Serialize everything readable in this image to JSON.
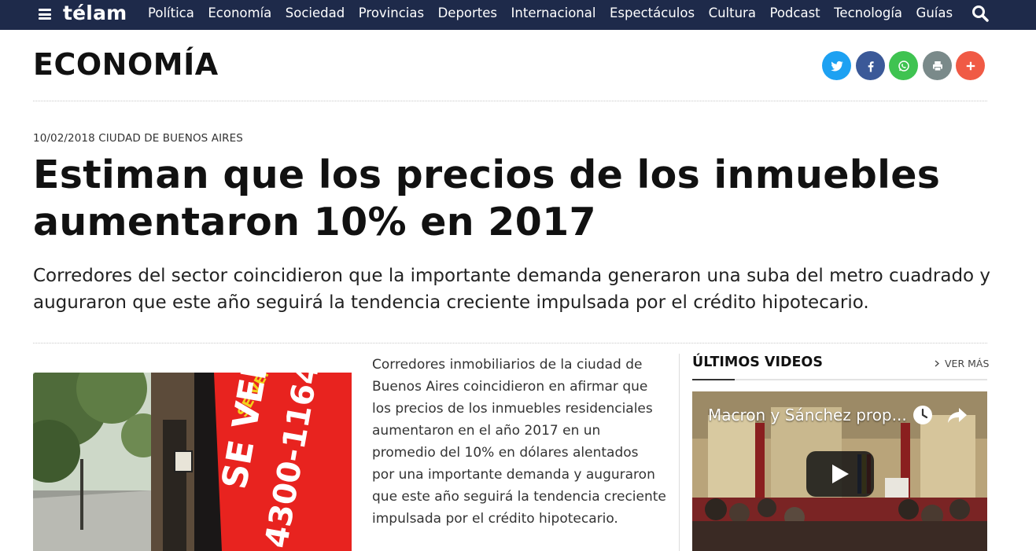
{
  "header": {
    "logo": "télam",
    "nav": [
      "Política",
      "Economía",
      "Sociedad",
      "Provincias",
      "Deportes",
      "Internacional",
      "Espectáculos",
      "Cultura",
      "Podcast",
      "Tecnología",
      "Guías"
    ]
  },
  "section": {
    "title": "ECONOMÍA"
  },
  "share_buttons": [
    {
      "name": "twitter",
      "color": "#1da1f2"
    },
    {
      "name": "facebook",
      "color": "#3b5998"
    },
    {
      "name": "whatsapp",
      "color": "#3fc351"
    },
    {
      "name": "print",
      "color": "#7a8a8a"
    },
    {
      "name": "more",
      "color": "#f05a45"
    }
  ],
  "article": {
    "dateline": "10/02/2018 CIUDAD DE BUENOS AIRES",
    "headline_line1": "Estiman que los precios de los inmuebles",
    "headline_line2": "aumentaron 10% en 2017",
    "subheadline": "Corredores del sector coincidieron que la importante demanda generaron una suba del metro cuadrado y auguraron que este año seguirá la tendencia creciente impulsada por el crédito hipotecario.",
    "body_lines": [
      "Corredores inmobiliarios de la ciudad de",
      "Buenos Aires coincidieron en afirmar que",
      "los precios de los inmuebles residenciales",
      "aumentaron en el año 2017 en un",
      "promedio del 10% en dólares alentados",
      "por una importante demanda y auguraron",
      "que este año seguirá la tendencia creciente",
      "impulsada por el crédito hipotecario."
    ],
    "photo_sign_text": "SE VENDEN",
    "photo_phone_text": "4300-1164"
  },
  "videos": {
    "title": "ÚLTIMOS VIDEOS",
    "more_label": "VER MÁS",
    "featured": {
      "title": "Macron y Sánchez prop..."
    }
  },
  "colors": {
    "navbar": "#1e2a4a",
    "accent_red": "#e8231f"
  }
}
